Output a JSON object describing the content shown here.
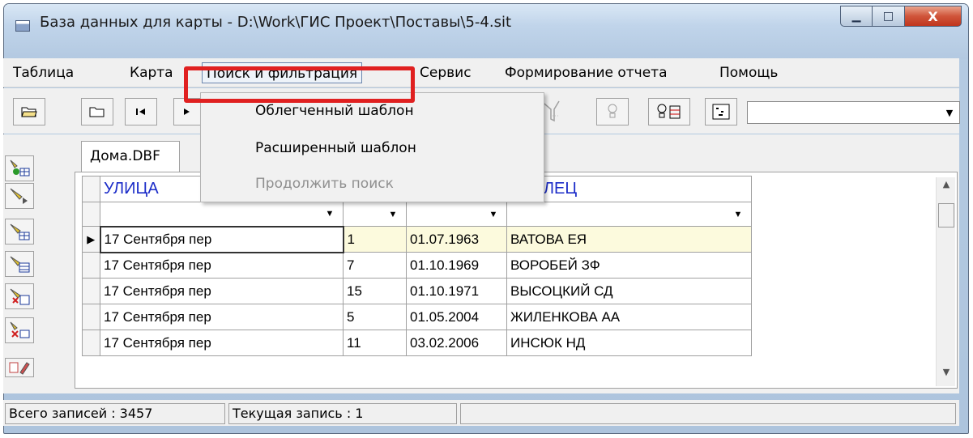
{
  "window": {
    "title": "База данных для карты - D:\\Work\\ГИС Проект\\Поставы\\5-4.sit",
    "controls": {
      "minimize": "▁",
      "maximize": "□",
      "close": "X"
    }
  },
  "menubar": {
    "items": [
      "Таблица",
      "Карта",
      "Поиск и фильтрация",
      "Сервис",
      "Формирование отчета",
      "Помощь"
    ],
    "active_index": 2
  },
  "dropdown": {
    "items": [
      {
        "label": "Облегченный шаблон",
        "enabled": true
      },
      {
        "label": "Расширенный шаблон",
        "enabled": true
      },
      {
        "label": "Продолжить поиск",
        "enabled": false
      }
    ]
  },
  "toolbar": {
    "buttons": [
      "open-folder-icon",
      "folder-icon",
      "first-record-icon",
      "prev-record-icon",
      "filter-icon",
      "bulb-icon",
      "bulb-table-icon",
      "coordinates-icon"
    ],
    "combo_value": ""
  },
  "tab": {
    "label": "Дома.DBF"
  },
  "grid": {
    "columns": [
      "УЛИЦА",
      "",
      "",
      "АДЕЛЕЦ"
    ],
    "rows": [
      [
        "17 Сентября пер",
        "1",
        "01.07.1963",
        "ВАТОВА ЕЯ"
      ],
      [
        "17 Сентября пер",
        "7",
        "01.10.1969",
        "ВОРОБЕЙ ЗФ"
      ],
      [
        "17 Сентября пер",
        "15",
        "01.10.1971",
        "ВЫСОЦКИЙ СД"
      ],
      [
        "17 Сентября пер",
        "5",
        "01.05.2004",
        "ЖИЛЕНКОВА АА"
      ],
      [
        "17 Сентября пер",
        "11",
        "03.02.2006",
        "ИНСЮК НД"
      ]
    ],
    "current_row": 0
  },
  "status": {
    "total": "Всего записей : 3457",
    "current": "Текущая запись : 1",
    "extra": ""
  },
  "colors": {
    "highlight": "#e02020",
    "header_text": "#1b2cc8",
    "current_row": "#fcfadd"
  }
}
